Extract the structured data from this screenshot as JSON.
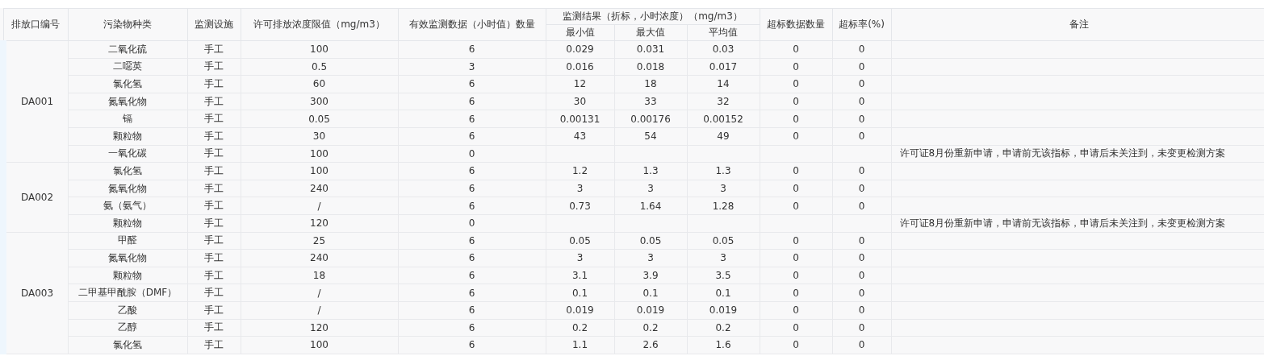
{
  "table": {
    "columns": [
      {
        "label": "排放口编号"
      },
      {
        "label": "污染物种类"
      },
      {
        "label": "监测设施"
      },
      {
        "label": "许可排放浓度限值（mg/m3）"
      },
      {
        "label": "有效监测数据（小时值）数量"
      },
      {
        "label": "监测结果（折标，小时浓度）（mg/m3）",
        "children": [
          "最小值",
          "最大值",
          "平均值"
        ]
      },
      {
        "label": "超标数据数量"
      },
      {
        "label": "超标率(%)"
      },
      {
        "label": "备注"
      }
    ],
    "groups": [
      {
        "outlet": "DA001",
        "rows": [
          {
            "pollutant": "二氧化硫",
            "facility": "手工",
            "limit": "100",
            "count": "6",
            "min": "0.029",
            "max": "0.031",
            "avg": "0.03",
            "exceed_count": "0",
            "exceed_rate": "0"
          },
          {
            "pollutant": "二噁英",
            "facility": "手工",
            "limit": "0.5",
            "count": "3",
            "min": "0.016",
            "max": "0.018",
            "avg": "0.017",
            "exceed_count": "0",
            "exceed_rate": "0"
          },
          {
            "pollutant": "氯化氢",
            "facility": "手工",
            "limit": "60",
            "count": "6",
            "min": "12",
            "max": "18",
            "avg": "14",
            "exceed_count": "0",
            "exceed_rate": "0"
          },
          {
            "pollutant": "氮氧化物",
            "facility": "手工",
            "limit": "300",
            "count": "6",
            "min": "30",
            "max": "33",
            "avg": "32",
            "exceed_count": "0",
            "exceed_rate": "0"
          },
          {
            "pollutant": "镉",
            "facility": "手工",
            "limit": "0.05",
            "count": "6",
            "min": "0.00131",
            "max": "0.00176",
            "avg": "0.00152",
            "exceed_count": "0",
            "exceed_rate": "0"
          },
          {
            "pollutant": "颗粒物",
            "facility": "手工",
            "limit": "30",
            "count": "6",
            "min": "43",
            "max": "54",
            "avg": "49",
            "exceed_count": "0",
            "exceed_rate": "0"
          },
          {
            "pollutant": "一氧化碳",
            "facility": "手工",
            "limit": "100",
            "count": "0",
            "remark": "许可证8月份重新申请，申请前无该指标，申请后未关注到，未变更检测方案"
          }
        ]
      },
      {
        "outlet": "DA002",
        "rows": [
          {
            "pollutant": "氯化氢",
            "facility": "手工",
            "limit": "100",
            "count": "6",
            "min": "1.2",
            "max": "1.3",
            "avg": "1.3",
            "exceed_count": "0",
            "exceed_rate": "0"
          },
          {
            "pollutant": "氮氧化物",
            "facility": "手工",
            "limit": "240",
            "count": "6",
            "min": "3",
            "max": "3",
            "avg": "3",
            "exceed_count": "0",
            "exceed_rate": "0"
          },
          {
            "pollutant": "氨（氨气）",
            "facility": "手工",
            "limit": "/",
            "count": "6",
            "min": "0.73",
            "max": "1.64",
            "avg": "1.28",
            "exceed_count": "0",
            "exceed_rate": "0"
          },
          {
            "pollutant": "颗粒物",
            "facility": "手工",
            "limit": "120",
            "count": "0",
            "remark": "许可证8月份重新申请，申请前无该指标，申请后未关注到，未变更检测方案"
          }
        ]
      },
      {
        "outlet": "DA003",
        "rows": [
          {
            "pollutant": "甲醛",
            "facility": "手工",
            "limit": "25",
            "count": "6",
            "min": "0.05",
            "max": "0.05",
            "avg": "0.05",
            "exceed_count": "0",
            "exceed_rate": "0"
          },
          {
            "pollutant": "氮氧化物",
            "facility": "手工",
            "limit": "240",
            "count": "6",
            "min": "3",
            "max": "3",
            "avg": "3",
            "exceed_count": "0",
            "exceed_rate": "0"
          },
          {
            "pollutant": "颗粒物",
            "facility": "手工",
            "limit": "18",
            "count": "6",
            "min": "3.1",
            "max": "3.9",
            "avg": "3.5",
            "exceed_count": "0",
            "exceed_rate": "0"
          },
          {
            "pollutant": "二甲基甲酰胺（DMF）",
            "facility": "手工",
            "limit": "/",
            "count": "6",
            "min": "0.1",
            "max": "0.1",
            "avg": "0.1",
            "exceed_count": "0",
            "exceed_rate": "0"
          },
          {
            "pollutant": "乙酸",
            "facility": "手工",
            "limit": "/",
            "count": "6",
            "min": "0.019",
            "max": "0.019",
            "avg": "0.019",
            "exceed_count": "0",
            "exceed_rate": "0"
          },
          {
            "pollutant": "乙醇",
            "facility": "手工",
            "limit": "120",
            "count": "6",
            "min": "0.2",
            "max": "0.2",
            "avg": "0.2",
            "exceed_count": "0",
            "exceed_rate": "0"
          },
          {
            "pollutant": "氯化氢",
            "facility": "手工",
            "limit": "100",
            "count": "6",
            "min": "1.1",
            "max": "2.6",
            "avg": "1.6",
            "exceed_count": "0",
            "exceed_rate": "0"
          }
        ]
      }
    ]
  }
}
